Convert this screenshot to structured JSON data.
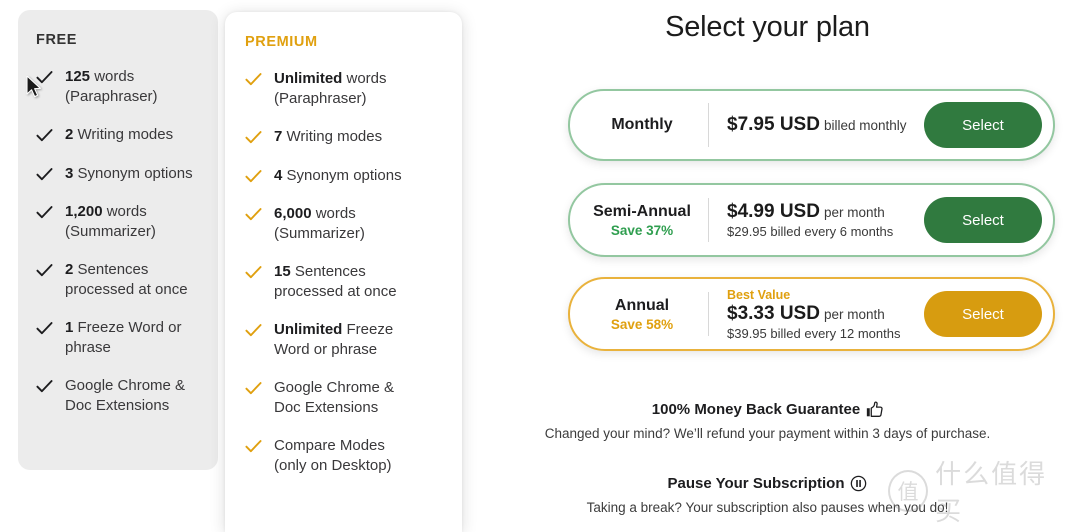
{
  "comparison": {
    "free": {
      "title": "FREE",
      "features": [
        {
          "strong": "125",
          "rest": " words",
          "line2": "(Paraphraser)"
        },
        {
          "strong": "2",
          "rest": " Writing modes",
          "line2": ""
        },
        {
          "strong": "3",
          "rest": " Synonym options",
          "line2": ""
        },
        {
          "strong": "1,200",
          "rest": " words",
          "line2": "(Summarizer)"
        },
        {
          "strong": "2",
          "rest": " Sentences",
          "line2": "processed at once"
        },
        {
          "strong": "1",
          "rest": " Freeze Word or",
          "line2": "phrase"
        },
        {
          "strong": "",
          "rest": "Google Chrome &",
          "line2": "Doc Extensions"
        }
      ]
    },
    "premium": {
      "title": "PREMIUM",
      "features": [
        {
          "strong": "Unlimited",
          "rest": " words",
          "line2": "(Paraphraser)"
        },
        {
          "strong": "7",
          "rest": " Writing modes",
          "line2": ""
        },
        {
          "strong": "4",
          "rest": " Synonym options",
          "line2": ""
        },
        {
          "strong": "6,000",
          "rest": " words",
          "line2": "(Summarizer)"
        },
        {
          "strong": "15",
          "rest": " Sentences",
          "line2": "processed at once"
        },
        {
          "strong": "Unlimited",
          "rest": " Freeze",
          "line2": "Word or phrase"
        },
        {
          "strong": "",
          "rest": "Google Chrome &",
          "line2": "Doc Extensions"
        },
        {
          "strong": "",
          "rest": "Compare Modes",
          "line2": "(only on Desktop)"
        }
      ]
    }
  },
  "panel": {
    "heading": "Select your plan",
    "plans": [
      {
        "name": "Monthly",
        "save": "",
        "badge": "",
        "price": "$7.95 USD",
        "price_note": "billed monthly",
        "billed": "",
        "button": "Select",
        "accent": "green"
      },
      {
        "name": "Semi-Annual",
        "save": "Save 37%",
        "badge": "",
        "price": "$4.99 USD",
        "price_note": "per month",
        "billed": "$29.95 billed every 6 months",
        "button": "Select",
        "accent": "green"
      },
      {
        "name": "Annual",
        "save": "Save 58%",
        "badge": "Best Value",
        "price": "$3.33 USD",
        "price_note": "per month",
        "billed": "$39.95 billed every 12 months",
        "button": "Select",
        "accent": "gold"
      }
    ],
    "guarantee": {
      "title": "100% Money Back Guarantee",
      "icon": "thumbs-up-icon",
      "sub": "Changed your mind? We’ll refund your payment within 3 days of purchase."
    },
    "pause": {
      "title": "Pause Your Subscription",
      "icon": "pause-circle-icon",
      "sub": "Taking a break? Your subscription also pauses when you do!"
    }
  },
  "watermark": {
    "mark": "值",
    "text": "什么值得买"
  },
  "colors": {
    "premium_accent": "#e0a00f",
    "green_accent": "#307a3f",
    "gold_accent": "#d79c10",
    "save_green": "#2f9e4f",
    "free_card_bg": "#ececec"
  }
}
